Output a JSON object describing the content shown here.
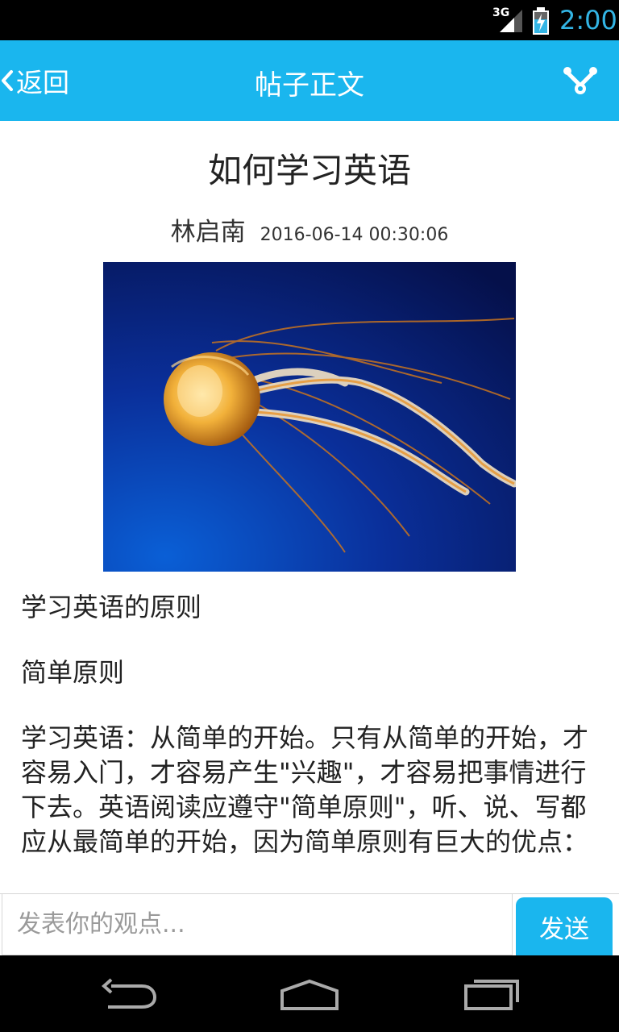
{
  "status_bar": {
    "network": "3G",
    "time": "2:00",
    "colors": {
      "accent": "#33b5e5"
    }
  },
  "header": {
    "back_label": "返回",
    "title": "帖子正文",
    "share_icon": "share-icon"
  },
  "post": {
    "title": "如何学习英语",
    "author": "林启南",
    "timestamp": "2016-06-14 00:30:06",
    "image_icon": "jellyfish-photo",
    "paragraphs": [
      "学习英语的原则",
      "简单原则",
      "学习英语：从简单的开始。只有从简单的开始，才容易入门，才容易产生\"兴趣\"，才容易把事情进行下去。英语阅读应遵守\"简单原则\"，听、说、写都应从最简单的开始，因为简单原则有巨大的优点："
    ]
  },
  "comment_bar": {
    "placeholder": "发表你的观点...",
    "value": "",
    "send_label": "发送"
  },
  "colors": {
    "title_bar": "#1ab6ee",
    "send_button": "#1ab6ee"
  },
  "nav_bar": {
    "icons": [
      "back-icon",
      "home-icon",
      "recent-apps-icon"
    ]
  }
}
